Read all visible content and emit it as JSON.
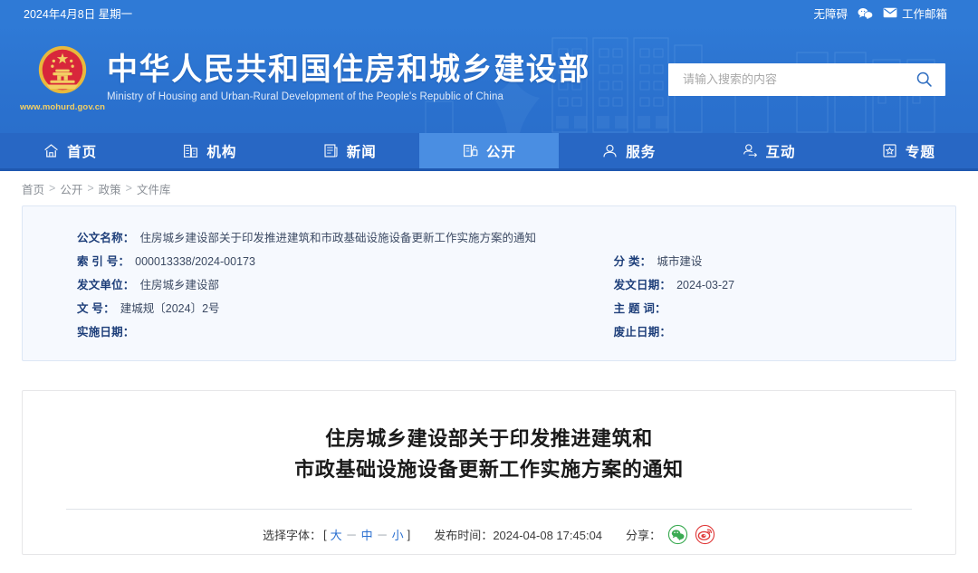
{
  "topbar": {
    "date": "2024年4月8日 星期一",
    "accessibility": "无障碍",
    "wechat_icon": "wechat-icon",
    "mail_icon": "mail-icon",
    "mailbox": "工作邮箱"
  },
  "header": {
    "emblem_icon": "national-emblem-icon",
    "site_url": "www.mohurd.gov.cn",
    "title_cn": "中华人民共和国住房和城乡建设部",
    "title_en": "Ministry of Housing and Urban-Rural Development of the People's Republic of China",
    "search": {
      "placeholder": "请输入搜索的内容",
      "value": "",
      "icon": "search-icon"
    },
    "colors": {
      "banner_blue": "#2f7ad6",
      "nav_blue": "#2867c4",
      "active_blue": "#4a8ee2",
      "emblem_gold": "#f3cf63",
      "emblem_red": "#d8273b"
    }
  },
  "nav": {
    "items": [
      {
        "label": "首页",
        "icon": "home-icon",
        "active": false
      },
      {
        "label": "机构",
        "icon": "building-icon",
        "active": false
      },
      {
        "label": "新闻",
        "icon": "news-icon",
        "active": false
      },
      {
        "label": "公开",
        "icon": "open-gov-icon",
        "active": true
      },
      {
        "label": "服务",
        "icon": "service-person-icon",
        "active": false
      },
      {
        "label": "互动",
        "icon": "interaction-icon",
        "active": false
      },
      {
        "label": "专题",
        "icon": "star-topic-icon",
        "active": false
      }
    ]
  },
  "breadcrumb": {
    "items": [
      "首页",
      "公开",
      "政策",
      "文件库"
    ],
    "separator": ">"
  },
  "meta": {
    "left": [
      {
        "label": "公文名称：",
        "value": "住房城乡建设部关于印发推进建筑和市政基础设施设备更新工作实施方案的通知"
      },
      {
        "label": "索 引 号：",
        "value": "000013338/2024-00173"
      },
      {
        "label": "发文单位：",
        "value": "住房城乡建设部"
      },
      {
        "label": "文     号：",
        "value": "建城规〔2024〕2号"
      },
      {
        "label": "实施日期：",
        "value": ""
      }
    ],
    "right": [
      {
        "label": "分     类：",
        "value": "城市建设"
      },
      {
        "label": "发文日期：",
        "value": "2024-03-27"
      },
      {
        "label": "主 题 词：",
        "value": ""
      },
      {
        "label": "废止日期：",
        "value": ""
      }
    ]
  },
  "article": {
    "title_line1": "住房城乡建设部关于印发推进建筑和",
    "title_line2": "市政基础设施设备更新工作实施方案的通知",
    "font_label": "选择字体：",
    "bracket_open": "[",
    "bracket_close": "]",
    "size_large": "大",
    "size_medium": "中",
    "size_small": "小",
    "dash": "－",
    "publish_label": "发布时间：",
    "publish_time": "2024-04-08 17:45:04",
    "share_label": "分享：",
    "share_icons": [
      "wechat-share-icon",
      "weibo-share-icon"
    ]
  }
}
